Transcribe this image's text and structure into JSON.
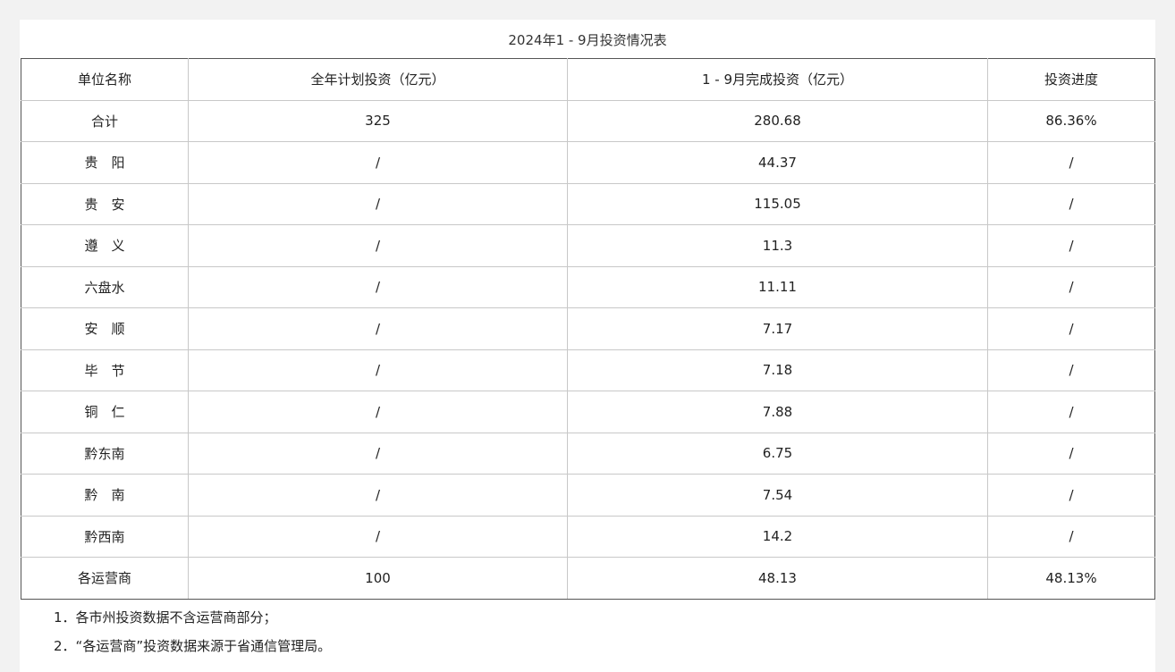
{
  "title": "2024年1 - 9月投资情况表",
  "columns": [
    "单位名称",
    "全年计划投资（亿元）",
    "1 - 9月完成投资（亿元）",
    "投资进度"
  ],
  "rows": [
    [
      "合计",
      "325",
      "280.68",
      "86.36%"
    ],
    [
      "贵　阳",
      "/",
      "44.37",
      "/"
    ],
    [
      "贵　安",
      "/",
      "115.05",
      "/"
    ],
    [
      "遵　义",
      "/",
      "11.3",
      "/"
    ],
    [
      "六盘水",
      "/",
      "11.11",
      "/"
    ],
    [
      "安　顺",
      "/",
      "7.17",
      "/"
    ],
    [
      "毕　节",
      "/",
      "7.18",
      "/"
    ],
    [
      "铜　仁",
      "/",
      "7.88",
      "/"
    ],
    [
      "黔东南",
      "/",
      "6.75",
      "/"
    ],
    [
      "黔　南",
      "/",
      "7.54",
      "/"
    ],
    [
      "黔西南",
      "/",
      "14.2",
      "/"
    ],
    [
      "各运营商",
      "100",
      "48.13",
      "48.13%"
    ]
  ],
  "notes": [
    "1．各市州投资数据不含运营商部分；",
    "2．“各运营商”投资数据来源于省通信管理局。"
  ]
}
